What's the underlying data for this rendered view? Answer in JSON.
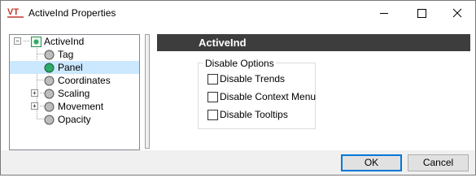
{
  "window": {
    "title": "ActiveInd Properties",
    "icon": "vt-app-icon",
    "controls": {
      "minimize": "minimize-icon",
      "maximize": "maximize-icon",
      "close": "close-icon"
    }
  },
  "tree": {
    "root": {
      "label": "ActiveInd",
      "expander": "−"
    },
    "items": [
      {
        "label": "Tag",
        "expander": ""
      },
      {
        "label": "Panel",
        "expander": "",
        "selected": true
      },
      {
        "label": "Coordinates",
        "expander": ""
      },
      {
        "label": "Scaling",
        "expander": "+"
      },
      {
        "label": "Movement",
        "expander": "+"
      },
      {
        "label": "Opacity",
        "expander": ""
      }
    ]
  },
  "panel": {
    "header": "ActiveInd",
    "group_title": "Disable Options",
    "options": [
      {
        "label": "Disable Trends",
        "checked": false
      },
      {
        "label": "Disable Context Menu",
        "checked": false
      },
      {
        "label": "Disable Tooltips",
        "checked": false
      }
    ]
  },
  "footer": {
    "ok_label": "OK",
    "cancel_label": "Cancel"
  },
  "colors": {
    "header_bg": "#3d3d3d",
    "selection": "#cce8ff",
    "node_gray": "#a8a8a8",
    "node_green": "#2eaa6a",
    "footer_bg": "#f0f0f0"
  }
}
